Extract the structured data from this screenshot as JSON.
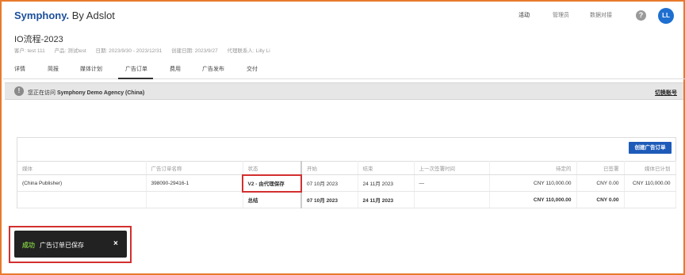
{
  "header": {
    "brand": "Symphony.",
    "by": " By Adslot",
    "nav": [
      "活动",
      "管理员",
      "数据对接"
    ],
    "help_label": "?",
    "avatar_initials": "LL"
  },
  "page": {
    "title": "IO流程-2023",
    "meta": [
      "客户: test 111",
      "产品: 测试test",
      "日期: 2023/9/30 - 2023/12/31",
      "创建日期: 2023/9/27",
      "代理联系人: Lilly Li"
    ]
  },
  "tabs": [
    "详情",
    "简报",
    "媒体计划",
    "广告订单",
    "费用",
    "广告发布",
    "交付"
  ],
  "active_tab": "广告订单",
  "banner": {
    "prefix": "您正在访问 ",
    "agency": "Symphony Demo Agency (China)",
    "switch_label": "切换账号"
  },
  "panel": {
    "create_button": "创建广告订单",
    "columns": [
      "媒体",
      "广告订单名称",
      "状态",
      "开始",
      "结束",
      "上一次签署时间",
      "待定的",
      "已签署",
      "媒体已计划"
    ],
    "rows": [
      {
        "media": "(China Publisher)",
        "order_name": "398090-29416-1",
        "status": "V2 - 由代理保存",
        "start": "07 10月 2023",
        "end": "24 11月 2023",
        "last_signed": "—",
        "pending": "CNY 110,000.00",
        "signed": "CNY 0.00",
        "planned": "CNY 110,000.00"
      }
    ],
    "total": {
      "label": "总结",
      "start": "07 10月 2023",
      "end": "24 11月 2023",
      "pending": "CNY 110,000.00",
      "signed": "CNY 0.00"
    }
  },
  "toast": {
    "status": "成功",
    "message": "广告订单已保存",
    "close": "×"
  }
}
